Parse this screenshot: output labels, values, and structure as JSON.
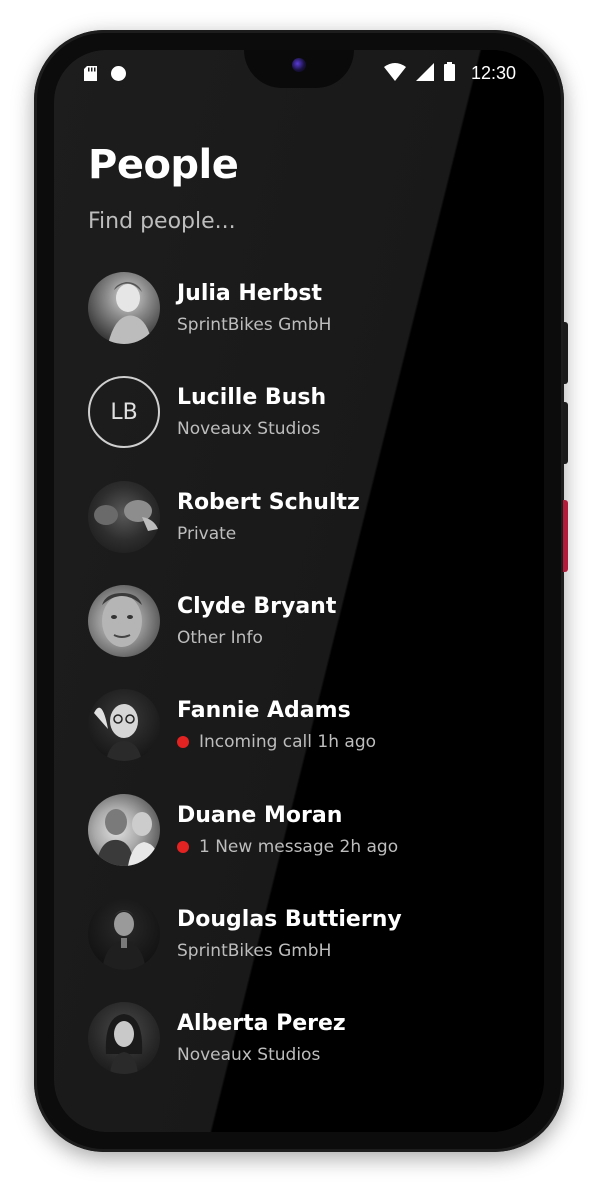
{
  "status_bar": {
    "time": "12:30",
    "icons": [
      "sd-card-icon",
      "circle-notification-icon",
      "wifi-icon",
      "signal-icon",
      "battery-icon"
    ]
  },
  "page": {
    "title": "People",
    "search_placeholder": "Find people..."
  },
  "people": [
    {
      "name": "Julia Herbst",
      "subtitle": "SprintBikes GmbH",
      "avatar": "photo"
    },
    {
      "name": "Lucille Bush",
      "subtitle": "Noveaux Studios",
      "avatar": "initials",
      "initials": "LB"
    },
    {
      "name": "Robert Schultz",
      "subtitle": "Private",
      "avatar": "photo"
    },
    {
      "name": "Clyde Bryant",
      "subtitle": "Other Info",
      "avatar": "photo"
    },
    {
      "name": "Fannie Adams",
      "subtitle": "Incoming call 1h ago",
      "avatar": "photo",
      "unread": true
    },
    {
      "name": "Duane Moran",
      "subtitle": "1 New message 2h ago",
      "avatar": "photo",
      "unread": true
    },
    {
      "name": "Douglas Buttierny",
      "subtitle": "SprintBikes GmbH",
      "avatar": "photo"
    },
    {
      "name": "Alberta Perez",
      "subtitle": "Noveaux Studios",
      "avatar": "photo"
    }
  ],
  "colors": {
    "background": "#000000",
    "text_primary": "#ffffff",
    "text_secondary": "#bdbdbd",
    "unread_dot": "#e32222",
    "side_button_accent": "#b31b3b"
  }
}
